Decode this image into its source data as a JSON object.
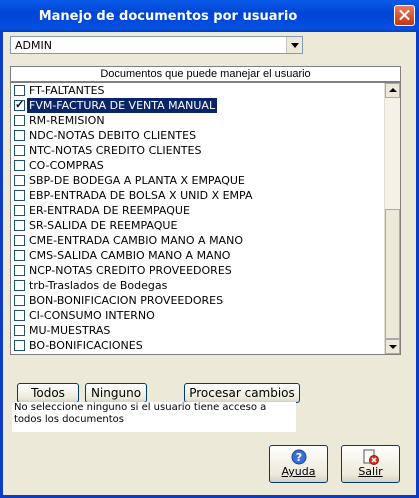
{
  "window": {
    "title": "Manejo de documentos por usuario"
  },
  "user_select": {
    "value": "ADMIN"
  },
  "list_header": "Documentos que puede manejar el usuario",
  "documents": [
    {
      "label": "FT-FALTANTES",
      "checked": false,
      "selected": false
    },
    {
      "label": "FVM-FACTURA DE VENTA MANUAL",
      "checked": true,
      "selected": true
    },
    {
      "label": "RM-REMISION",
      "checked": false,
      "selected": false
    },
    {
      "label": "NDC-NOTAS DEBITO CLIENTES",
      "checked": false,
      "selected": false
    },
    {
      "label": "NTC-NOTAS CREDITO CLIENTES",
      "checked": false,
      "selected": false
    },
    {
      "label": "CO-COMPRAS",
      "checked": false,
      "selected": false
    },
    {
      "label": "SBP-DE BODEGA A PLANTA X EMPAQUE",
      "checked": false,
      "selected": false
    },
    {
      "label": "EBP-ENTRADA DE BOLSA X UNID X EMPA",
      "checked": false,
      "selected": false
    },
    {
      "label": "ER-ENTRADA DE REEMPAQUE",
      "checked": false,
      "selected": false
    },
    {
      "label": "SR-SALIDA DE REEMPAQUE",
      "checked": false,
      "selected": false
    },
    {
      "label": "CME-ENTRADA CAMBIO MANO A MANO",
      "checked": false,
      "selected": false
    },
    {
      "label": "CMS-SALIDA CAMBIO MANO A MANO",
      "checked": false,
      "selected": false
    },
    {
      "label": "NCP-NOTAS CREDITO PROVEEDORES",
      "checked": false,
      "selected": false
    },
    {
      "label": "trb-Traslados de Bodegas",
      "checked": false,
      "selected": false
    },
    {
      "label": "BON-BONIFICACION PROVEEDORES",
      "checked": false,
      "selected": false
    },
    {
      "label": "CI-CONSUMO INTERNO",
      "checked": false,
      "selected": false
    },
    {
      "label": "MU-MUESTRAS",
      "checked": false,
      "selected": false
    },
    {
      "label": "BO-BONIFICACIONES",
      "checked": false,
      "selected": false
    }
  ],
  "buttons": {
    "todos": "Todos",
    "ninguno": "Ninguno",
    "procesar": "Procesar cambios",
    "ayuda": "Ayuda",
    "salir": "Salir"
  },
  "note": "No seleccione ninguno si el usuario tiene acceso a todos los documentos"
}
